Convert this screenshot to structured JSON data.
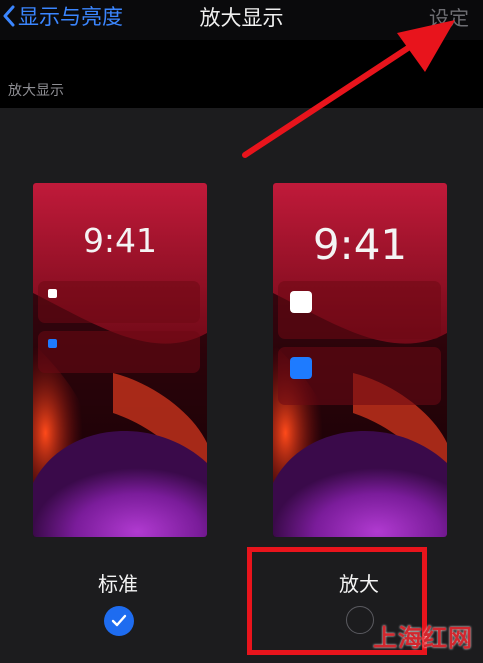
{
  "nav": {
    "back_label": "显示与亮度",
    "title": "放大显示",
    "right_label": "设定"
  },
  "section": {
    "header": "放大显示"
  },
  "options": [
    {
      "label": "标准",
      "time": "9:41",
      "selected": true
    },
    {
      "label": "放大",
      "time": "9:41",
      "selected": false
    }
  ],
  "watermark": "上海红网",
  "colors": {
    "accent": "#1e6cf0",
    "annotation": "#e8141c"
  }
}
